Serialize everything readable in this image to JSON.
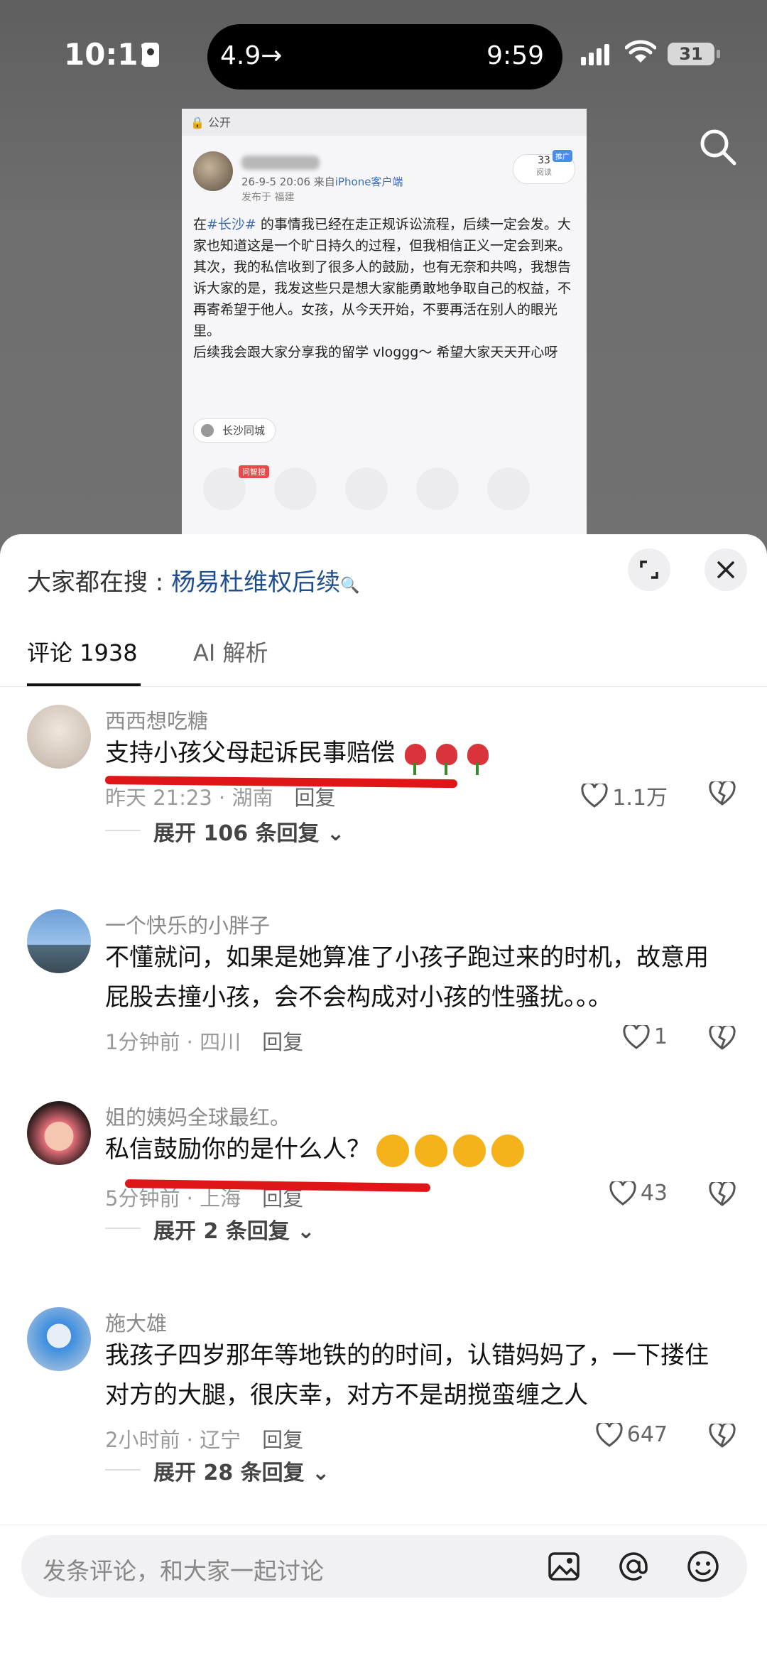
{
  "status_bar": {
    "time": "10:11",
    "island_left": "4.9→",
    "island_right": "9:59",
    "battery": "31"
  },
  "preview": {
    "visibility": "公开",
    "date": "26-9-5 20:06",
    "source_prefix": "来自",
    "source": "iPhone客户端",
    "location": "发布于 福建",
    "read_count": "33",
    "read_label": "阅读",
    "push_badge": "推广",
    "tag": "#长沙#",
    "body_after_tag": " 的事情我已经在走正规诉讼流程，后续一定会发。大家也知道这是一个旷日持久的过程，但我相信正义一定会到来。",
    "body_2": "其次，我的私信收到了很多人的鼓励，也有无奈和共鸣，我想告诉大家的是，我发这些只是想大家能勇敢地争取自己的权益，不再寄希望于他人。女孩，从今天开始，不要再活在别人的眼光里。",
    "body_3": "后续我会跟大家分享我的留学 vloggg～ 希望大家天天开心呀",
    "city_chip": "长沙同城",
    "hot_badge": "问智搜"
  },
  "sheet": {
    "hot_search_label": "大家都在搜 : ",
    "hot_search_keyword": "杨易杜维权后续",
    "tab_comments": "评论 1938",
    "tab_ai": "AI 解析"
  },
  "comments": [
    {
      "user": "西西想吃糖",
      "text": "支持小孩父母起诉民事赔偿",
      "time": "昨天 21:23 · 湖南",
      "reply": "回复",
      "likes": "1.1万",
      "expand": "展开 106 条回复"
    },
    {
      "user": "一个快乐的小胖子",
      "text": "不懂就问，如果是她算准了小孩子跑过来的时机，故意用屁股去撞小孩，会不会构成对小孩的性骚扰。。。",
      "time": "1分钟前 · 四川",
      "reply": "回复",
      "likes": "1"
    },
    {
      "user": "姐的姨妈全球最红。",
      "text": "私信鼓励你的是什么人？",
      "time": "5分钟前 · 上海",
      "reply": "回复",
      "likes": "43",
      "expand": "展开 2 条回复"
    },
    {
      "user": "施大雄",
      "text": "我孩子四岁那年等地铁的的时间，认错妈妈了，一下搂住对方的大腿，很庆幸，对方不是胡搅蛮缠之人",
      "time": "2小时前 · 辽宁",
      "reply": "回复",
      "likes": "647",
      "expand": "展开 28 条回复"
    }
  ],
  "input": {
    "placeholder": "发条评论，和大家一起讨论"
  }
}
